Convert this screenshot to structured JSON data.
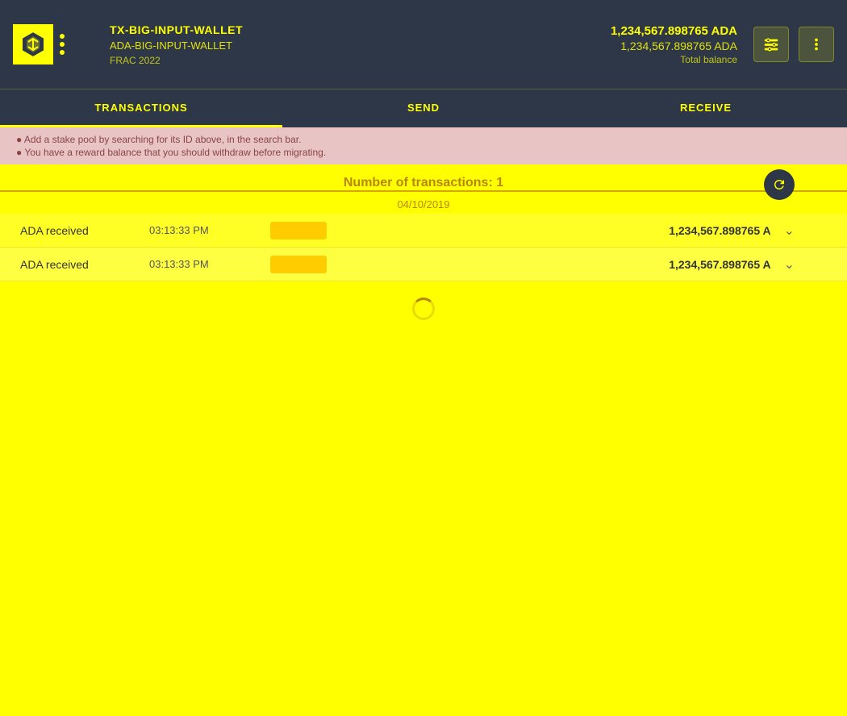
{
  "header": {
    "wallet_name_primary": "TX-BIG-INPUT-WALLET",
    "wallet_name_secondary": "ADA-BIG-INPUT-WALLET",
    "wallet_era": "FRAC 2022",
    "balance_primary": "1,234,567.898765 ADA",
    "balance_secondary": "1,234,567.898765 ADA",
    "balance_label": "Total balance"
  },
  "nav": {
    "tabs": [
      {
        "id": "transactions",
        "label": "TRANSACTIONS",
        "active": true
      },
      {
        "id": "send",
        "label": "SEND",
        "active": false
      },
      {
        "id": "receive",
        "label": "RECEIVE",
        "active": false
      }
    ]
  },
  "alert": {
    "line1": "● Add a stake pool by searching for its ID above, in the search bar.",
    "line2": "● You have a reward balance that you should withdraw before migrating."
  },
  "transactions": {
    "count_label": "Number of transactions:",
    "count": "1",
    "date": "04/10/2019",
    "rows": [
      {
        "type": "ADA received",
        "time": "03:13:33 PM",
        "amount": "1,234,567.898765 A",
        "expanded": false
      },
      {
        "type": "ADA received",
        "time": "03:13:33 PM",
        "amount": "1,234,567.898765 A",
        "expanded": false
      }
    ]
  }
}
